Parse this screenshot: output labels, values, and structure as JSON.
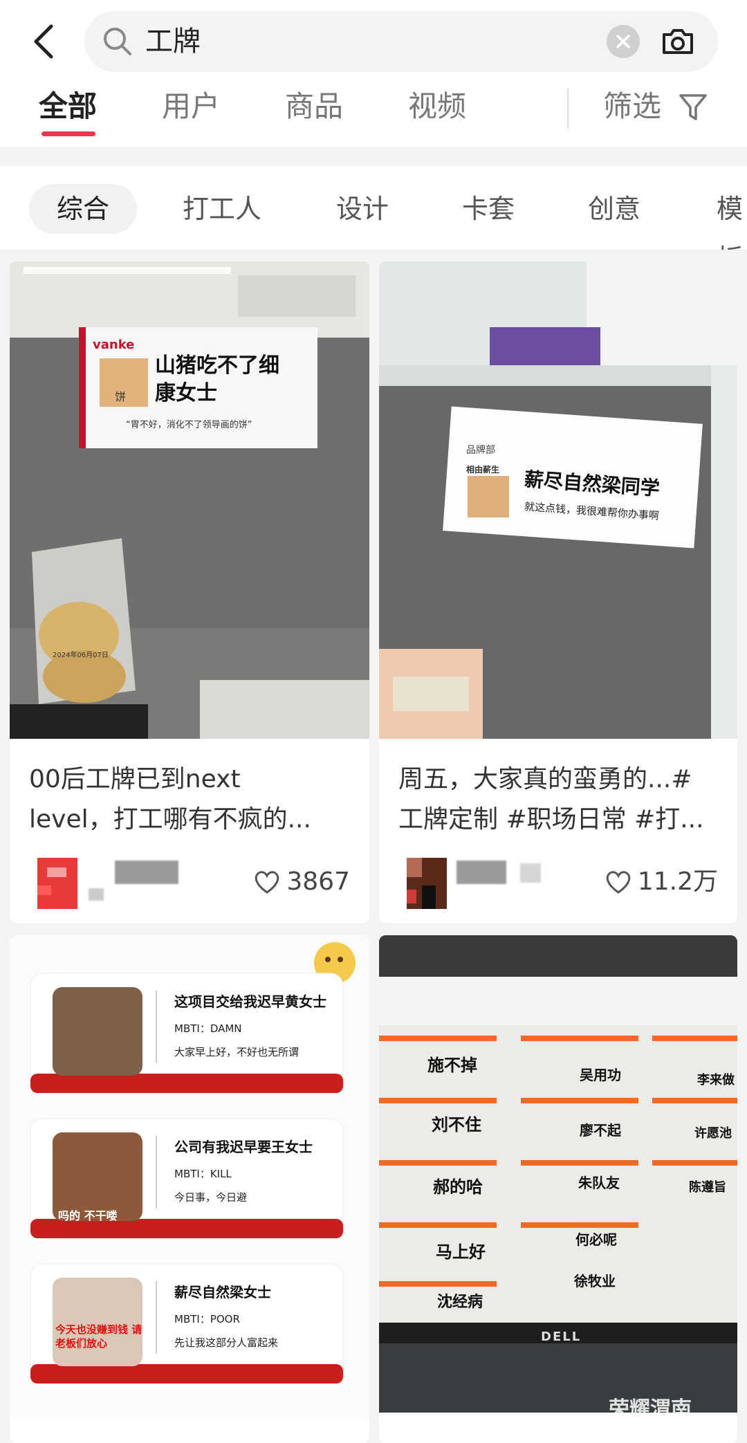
{
  "search": {
    "query": "工牌"
  },
  "tabs": [
    "全部",
    "用户",
    "商品",
    "视频"
  ],
  "filter_label": "筛选",
  "chips": [
    "综合",
    "打工人",
    "设计",
    "卡套",
    "创意",
    "模板"
  ],
  "cards": [
    {
      "title_line1": "00后工牌已到next",
      "title_line2": "level，打工哪有不疯的...",
      "likes": "3867",
      "sign_brand": "vanke",
      "sign_name_1": "山猪吃不了细",
      "sign_name_2": "康女士",
      "sign_sub": "“胃不好，消化不了领导画的饼”",
      "sign_sticker": "饼",
      "bag_date": "2024年06月07日"
    },
    {
      "title_line1": "周五，大家真的蛮勇的...#",
      "title_line2": "工牌定制 #职场日常 #打...",
      "likes": "11.2万",
      "sign_dept": "品牌部",
      "sign_small": "相由薪生",
      "sign_name": "薪尽自然梁同学",
      "sign_sub": "就这点钱，我很难帮你办事啊"
    },
    {
      "badges": [
        {
          "name": "这项目交给我迟早黄女士",
          "mbti": "MBTI：DAMN",
          "motto": "大家早上好，不好也无所谓",
          "photo_text": ""
        },
        {
          "name": "公司有我迟早要王女士",
          "mbti": "MBTI：KILL",
          "motto": "今日事，今日避",
          "photo_text": "吗的 不干喽"
        },
        {
          "name": "薪尽自然梁女士",
          "mbti": "MBTI：POOR",
          "motto": "先让我这部分人富起来",
          "photo_text": "今天也没赚到钱 请老板们放心"
        }
      ]
    },
    {
      "screen_names": [
        "施不掉",
        "吴用功",
        "李来做",
        "刘不住",
        "廖不起",
        "许愿池",
        "郝的哈",
        "朱队友",
        "陈遵旨",
        "马上好",
        "何必呢",
        "沈经病",
        "徐牧业"
      ],
      "monitor_brand": "DELL"
    }
  ],
  "watermark": "荣耀渭南",
  "colors": {
    "accent": "#e6394a",
    "badge_red": "#c81e1e"
  }
}
